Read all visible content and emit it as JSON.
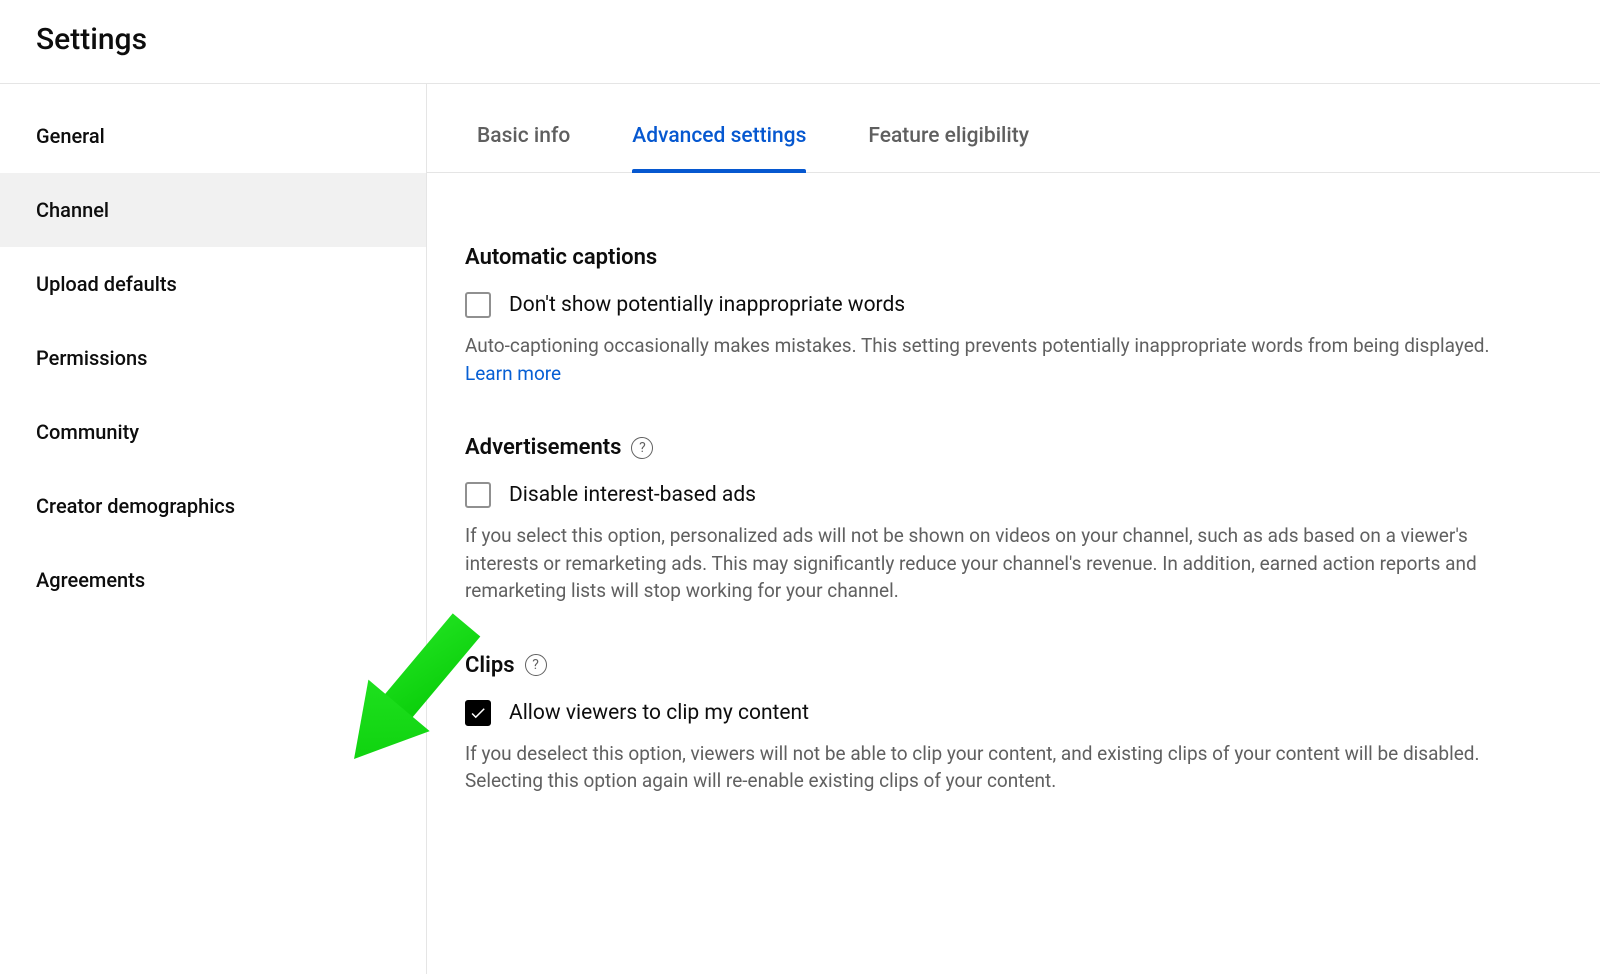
{
  "header": {
    "title": "Settings"
  },
  "sidebar": {
    "items": [
      {
        "label": "General",
        "selected": false
      },
      {
        "label": "Channel",
        "selected": true
      },
      {
        "label": "Upload defaults",
        "selected": false
      },
      {
        "label": "Permissions",
        "selected": false
      },
      {
        "label": "Community",
        "selected": false
      },
      {
        "label": "Creator demographics",
        "selected": false
      },
      {
        "label": "Agreements",
        "selected": false
      }
    ]
  },
  "tabs": [
    {
      "label": "Basic info",
      "active": false
    },
    {
      "label": "Advanced settings",
      "active": true
    },
    {
      "label": "Feature eligibility",
      "active": false
    }
  ],
  "sections": {
    "captions": {
      "title": "Automatic captions",
      "checkbox_label": "Don't show potentially inappropriate words",
      "checked": false,
      "description": "Auto-captioning occasionally makes mistakes. This setting prevents potentially inappropriate words from being displayed. ",
      "learn_more": "Learn more"
    },
    "ads": {
      "title": "Advertisements",
      "checkbox_label": "Disable interest-based ads",
      "checked": false,
      "description": "If you select this option, personalized ads will not be shown on videos on your channel, such as ads based on a viewer's interests or remarketing ads. This may significantly reduce your channel's revenue. In addition, earned action reports and remarketing lists will stop working for your channel."
    },
    "clips": {
      "title": "Clips",
      "checkbox_label": "Allow viewers to clip my content",
      "checked": true,
      "description": "If you deselect this option, viewers will not be able to clip your content, and existing clips of your content will be disabled. Selecting this option again will re-enable existing clips of your content."
    }
  }
}
